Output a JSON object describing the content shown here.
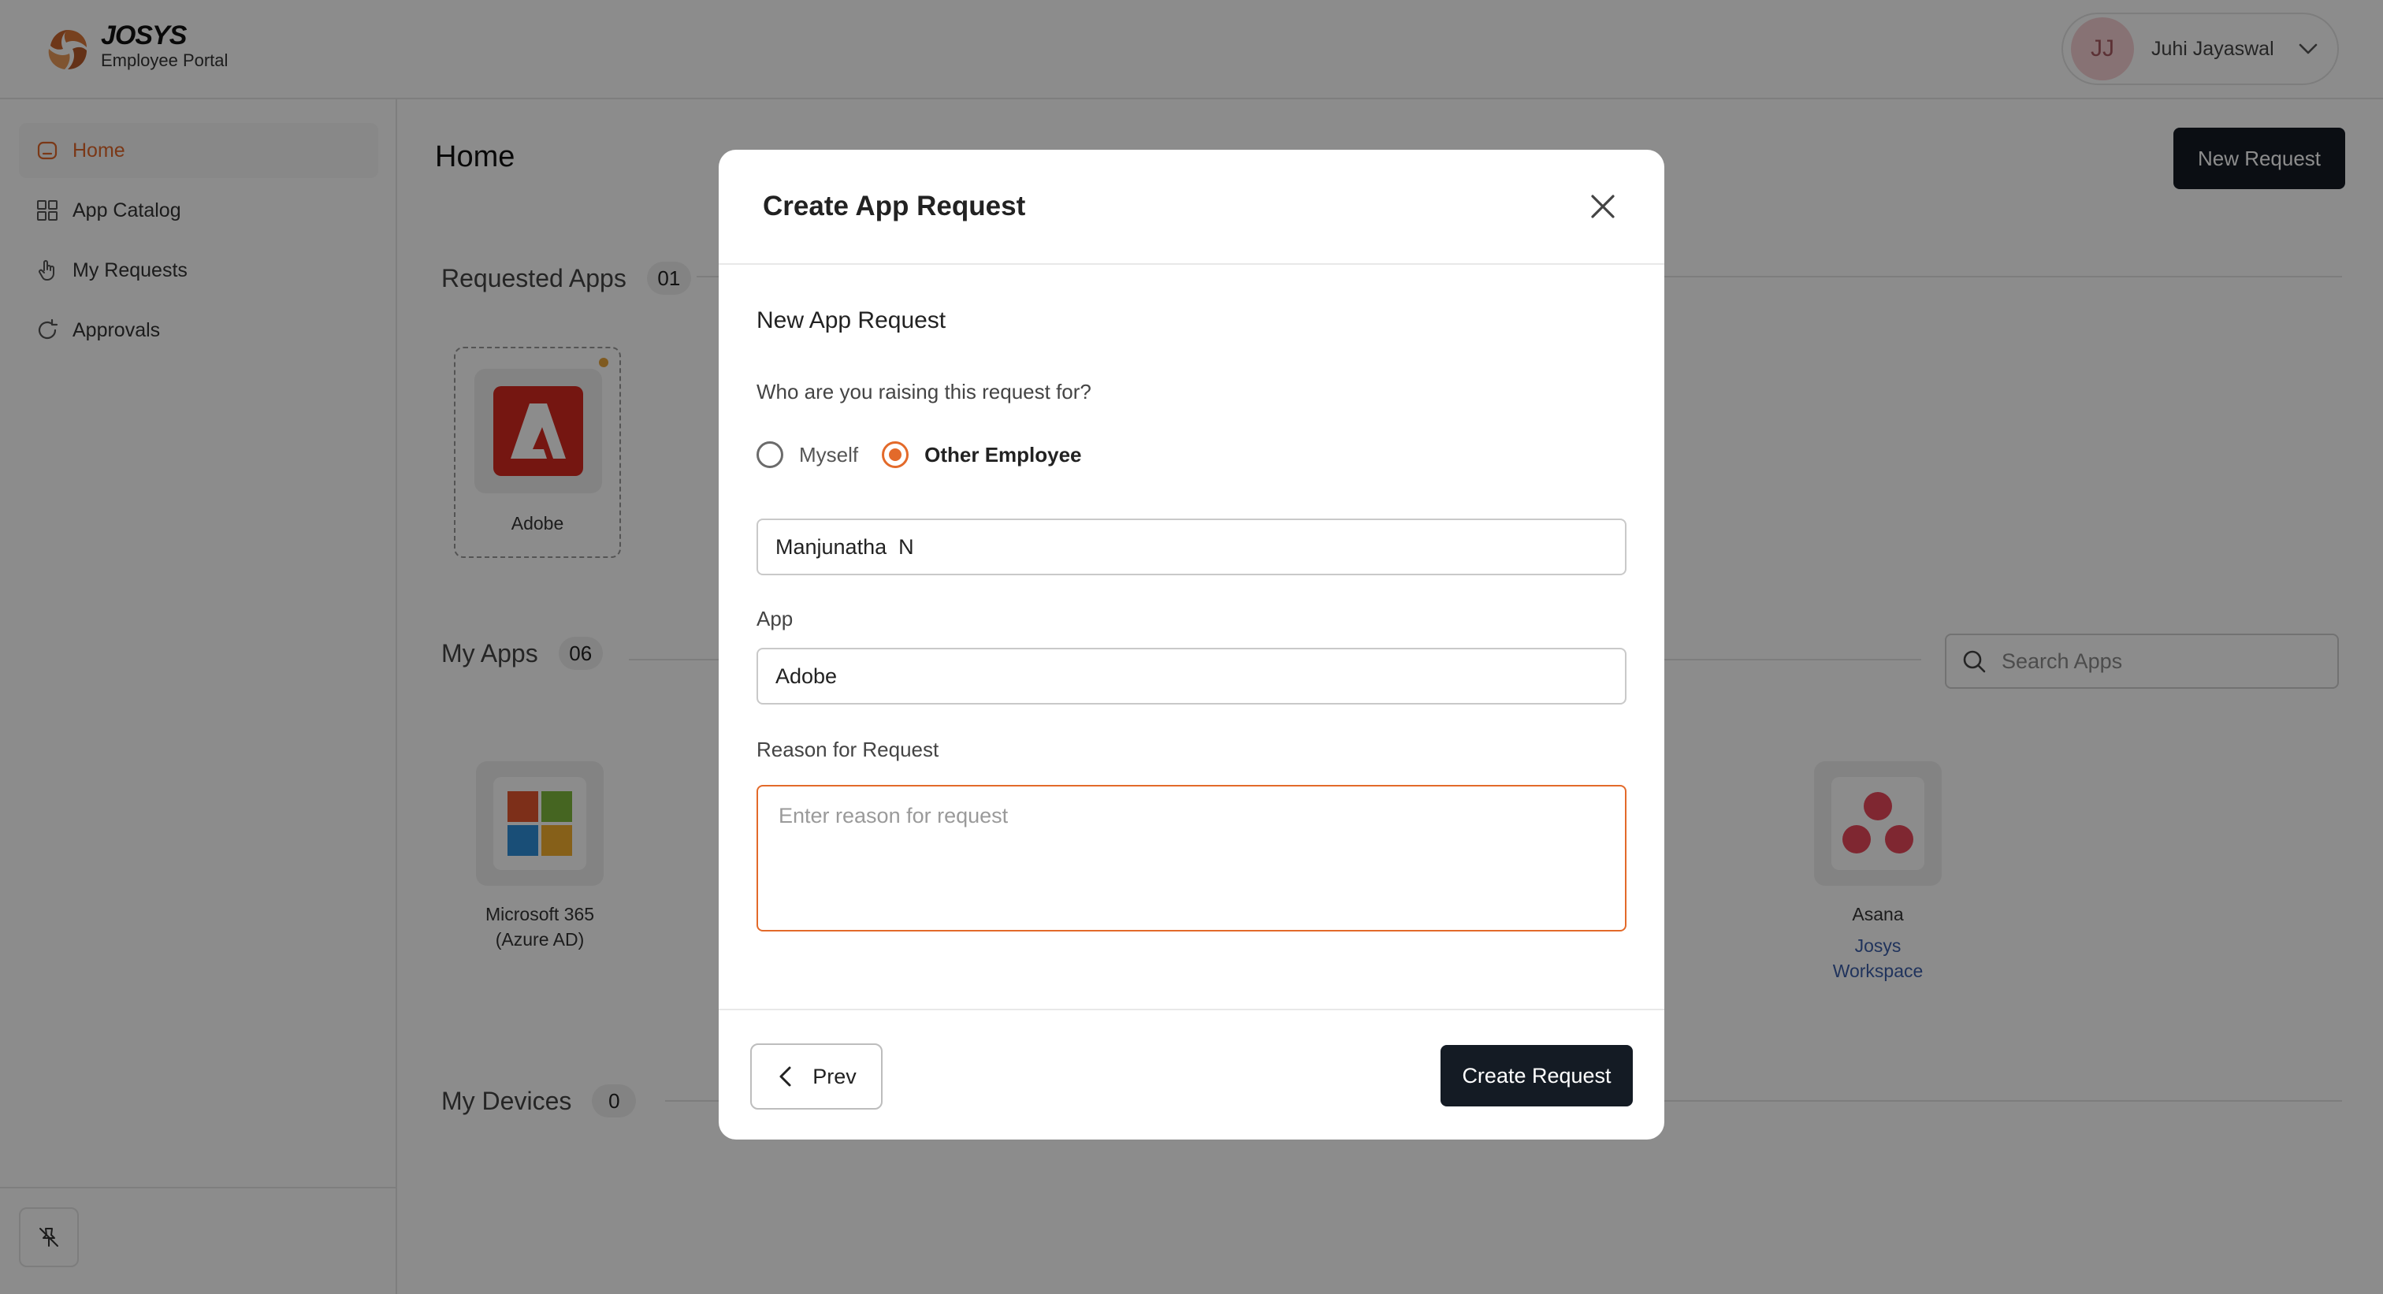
{
  "header": {
    "brand_name": "JOSYS",
    "brand_sub": "Employee Portal",
    "user_initials": "JJ",
    "user_name": "Juhi Jayaswal"
  },
  "sidebar": {
    "items": [
      {
        "label": "Home",
        "icon": "home-icon",
        "active": true
      },
      {
        "label": "App Catalog",
        "icon": "grid-icon",
        "active": false
      },
      {
        "label": "My Requests",
        "icon": "hand-pointer-icon",
        "active": false
      },
      {
        "label": "Approvals",
        "icon": "refresh-icon",
        "active": false
      }
    ],
    "collapse_icon": "unpin-icon"
  },
  "main": {
    "title": "Home",
    "new_request_label": "New Request",
    "requested_apps": {
      "title": "Requested Apps",
      "count": "01",
      "items": [
        {
          "name": "Adobe"
        }
      ]
    },
    "my_apps": {
      "title": "My Apps",
      "count": "06",
      "search_placeholder": "Search Apps",
      "items": [
        {
          "name": "Microsoft 365 (Azure AD)",
          "line1": "Microsoft 365",
          "line2": "(Azure AD)"
        },
        {
          "name": "Asana",
          "line1": "Asana",
          "sub1": "Josys",
          "sub2": "Workspace"
        }
      ]
    },
    "my_devices": {
      "title": "My Devices",
      "count": "0"
    }
  },
  "modal": {
    "title": "Create App Request",
    "subtitle": "New App Request",
    "question": "Who are you raising this request for?",
    "options": [
      {
        "label": "Myself",
        "checked": false
      },
      {
        "label": "Other Employee",
        "checked": true
      }
    ],
    "employee_value": "Manjunatha  N",
    "app_label": "App",
    "app_value": "Adobe",
    "reason_label": "Reason for Request",
    "reason_placeholder": "Enter reason for request",
    "prev_label": "Prev",
    "create_label": "Create Request"
  },
  "colors": {
    "accent": "#e36a2a",
    "primary_dark": "#141b24",
    "link": "#3b5ea8"
  }
}
